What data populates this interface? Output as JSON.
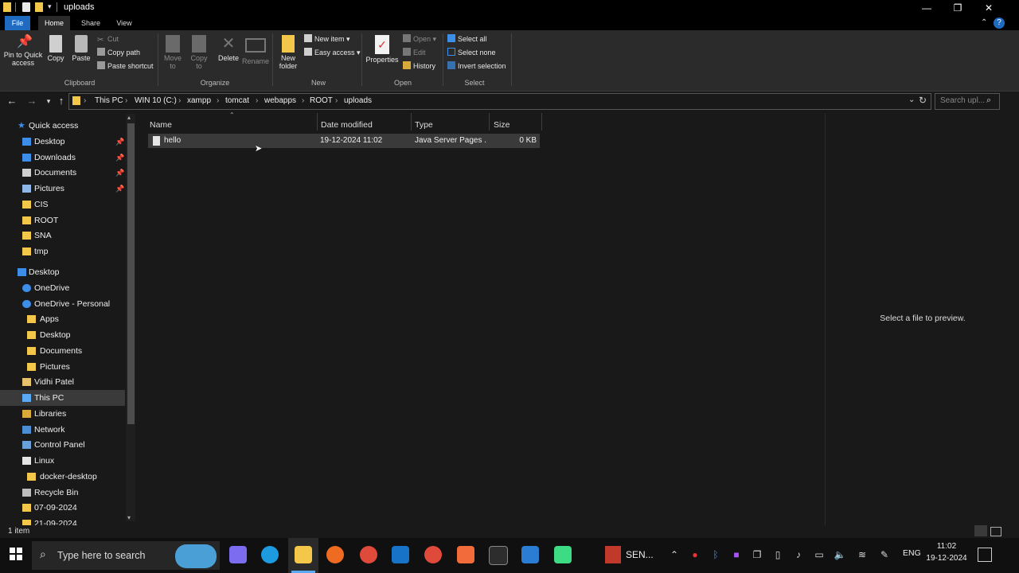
{
  "window": {
    "title": "uploads",
    "minimize_icon": "minimize-icon",
    "maximize_icon": "restore-icon",
    "close_icon": "close-icon"
  },
  "ribbon_tabs": [
    "File",
    "Home",
    "Share",
    "View"
  ],
  "ribbon": {
    "clipboard": {
      "label": "Clipboard",
      "pin_to_quick_access": "Pin to Quick access",
      "copy": "Copy",
      "paste": "Paste",
      "cut": "Cut",
      "copy_path": "Copy path",
      "paste_shortcut": "Paste shortcut"
    },
    "organize": {
      "label": "Organize",
      "move_to": "Move to",
      "copy_to": "Copy to",
      "delete": "Delete",
      "rename": "Rename"
    },
    "new": {
      "label": "New",
      "new_folder": "New folder",
      "new_item": "New item",
      "easy_access": "Easy access"
    },
    "open": {
      "label": "Open",
      "properties": "Properties",
      "open": "Open",
      "edit": "Edit",
      "history": "History"
    },
    "select": {
      "label": "Select",
      "select_all": "Select all",
      "select_none": "Select none",
      "invert_selection": "Invert selection"
    }
  },
  "address_bar": {
    "breadcrumbs": [
      "This PC",
      "WIN 10 (C:)",
      "xampp",
      "tomcat",
      "webapps",
      "ROOT",
      "uploads"
    ],
    "search_placeholder": "Search upl..."
  },
  "nav_pane": {
    "quick_access_label": "Quick access",
    "quick_access": [
      {
        "label": "Desktop",
        "icon": "desktop-icon",
        "pinned": true
      },
      {
        "label": "Downloads",
        "icon": "download-icon",
        "pinned": true
      },
      {
        "label": "Documents",
        "icon": "documents-icon",
        "pinned": true
      },
      {
        "label": "Pictures",
        "icon": "pictures-icon",
        "pinned": true
      },
      {
        "label": "CIS",
        "icon": "folder-icon",
        "pinned": false
      },
      {
        "label": "ROOT",
        "icon": "folder-icon",
        "pinned": false
      },
      {
        "label": "SNA",
        "icon": "folder-icon",
        "pinned": false
      },
      {
        "label": "tmp",
        "icon": "folder-icon",
        "pinned": false
      }
    ],
    "tree": [
      {
        "label": "Desktop",
        "icon": "desktop-icon"
      },
      {
        "label": "OneDrive",
        "icon": "cloud-icon"
      },
      {
        "label": "OneDrive - Personal",
        "icon": "cloud-icon"
      },
      {
        "label": "Apps",
        "icon": "folder-icon"
      },
      {
        "label": "Desktop",
        "icon": "folder-icon"
      },
      {
        "label": "Documents",
        "icon": "folder-icon"
      },
      {
        "label": "Pictures",
        "icon": "folder-icon"
      },
      {
        "label": "Vidhi Patel",
        "icon": "user-folder-icon"
      },
      {
        "label": "This PC",
        "icon": "computer-icon"
      },
      {
        "label": "Libraries",
        "icon": "libraries-icon"
      },
      {
        "label": "Network",
        "icon": "network-icon"
      },
      {
        "label": "Control Panel",
        "icon": "control-panel-icon"
      },
      {
        "label": "Linux",
        "icon": "linux-icon"
      },
      {
        "label": "docker-desktop",
        "icon": "folder-icon"
      },
      {
        "label": "Recycle Bin",
        "icon": "recycle-bin-icon"
      },
      {
        "label": "07-09-2024",
        "icon": "folder-icon"
      },
      {
        "label": "21-09-2024",
        "icon": "folder-icon"
      }
    ]
  },
  "file_list": {
    "columns": [
      "Name",
      "Date modified",
      "Type",
      "Size"
    ],
    "rows": [
      {
        "name": "hello",
        "date_modified": "19-12-2024 11:02",
        "type": "Java Server Pages ...",
        "size": "0 KB"
      }
    ]
  },
  "preview": {
    "message": "Select a file to preview."
  },
  "status": {
    "item_count": "1 item"
  },
  "taskbar": {
    "search_placeholder": "Type here to search",
    "pinned_apps": [
      "copilot-icon",
      "edge-icon",
      "file-explorer-icon",
      "firefox-icon",
      "chrome-icon",
      "app-icon",
      "chrome-icon",
      "xampp-icon",
      "terminal-icon",
      "vscode-icon",
      "android-studio-icon"
    ],
    "active_app_label": "SEN...",
    "language": "ENG",
    "time": "11:02",
    "date": "19-12-2024"
  },
  "colors": {
    "background": "#191919",
    "ribbon": "#2b2b2b",
    "accent": "#1f6bc2",
    "folder": "#f3c84a",
    "selection": "#3a3a3a"
  }
}
